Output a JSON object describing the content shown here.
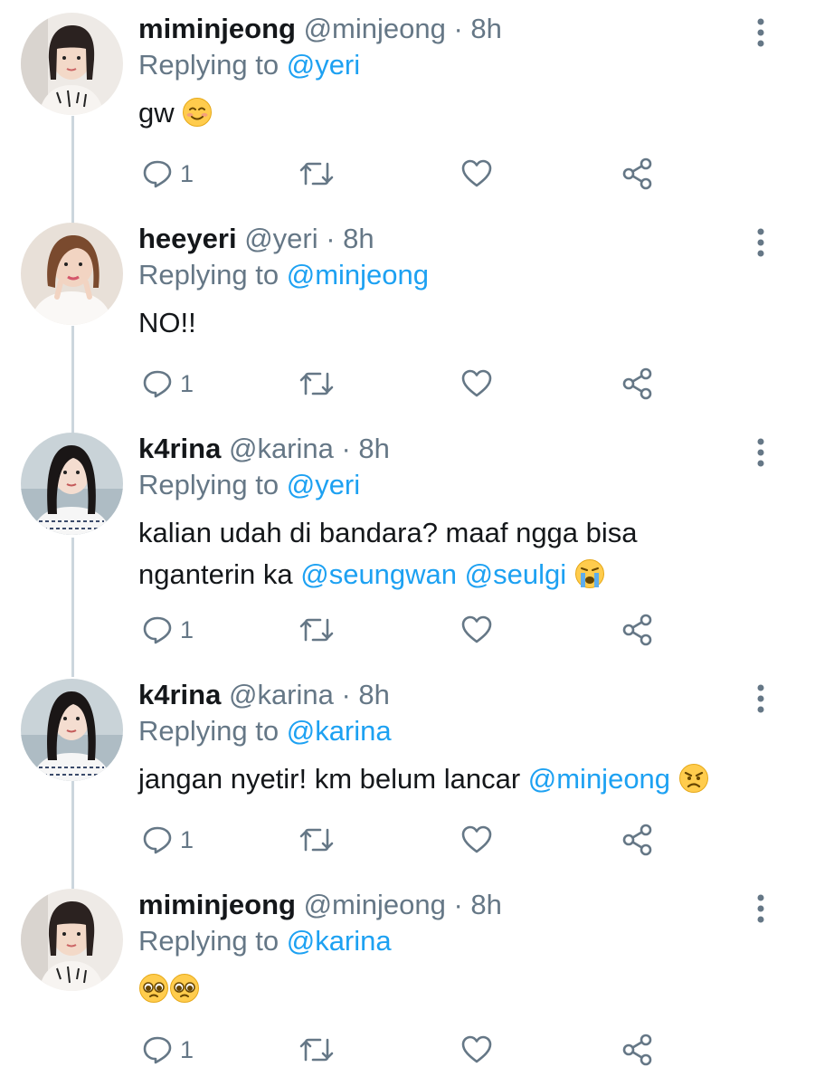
{
  "replies": [
    {
      "display_name": "miminjeong",
      "handle": "@minjeong",
      "time": "· 8h",
      "replying_label": "Replying to",
      "replying_to": "@yeri",
      "text_1": "gw",
      "emoji": "smiling-face-icon",
      "reply_count": "1",
      "avatar": "avatar-miminjeong"
    },
    {
      "display_name": "heeyeri",
      "handle": "@yeri",
      "time": "· 8h",
      "replying_label": "Replying to",
      "replying_to": "@minjeong",
      "text_1": "NO!!",
      "reply_count": "1",
      "avatar": "avatar-heeyeri"
    },
    {
      "display_name": "k4rina",
      "handle": "@karina",
      "time": "· 8h",
      "replying_label": "Replying to",
      "replying_to": "@yeri",
      "text_1": "kalian udah di bandara? maaf ngga bisa",
      "text_2": "nganterin ka ",
      "mention_1": "@seungwan",
      "mention_2": "@seulgi",
      "emoji": "loudly-crying-face-icon",
      "reply_count": "1",
      "avatar": "avatar-k4rina"
    },
    {
      "display_name": "k4rina",
      "handle": "@karina",
      "time": "· 8h",
      "replying_label": "Replying to",
      "replying_to": "@karina",
      "text_1": "jangan nyetir! km belum lancar ",
      "mention_1": "@minjeong",
      "emoji": "angry-face-icon",
      "reply_count": "1",
      "avatar": "avatar-k4rina"
    },
    {
      "display_name": "miminjeong",
      "handle": "@minjeong",
      "time": "· 8h",
      "replying_label": "Replying to",
      "replying_to": "@karina",
      "emoji": "pleading-face-icon",
      "reply_count": "1",
      "avatar": "avatar-miminjeong"
    }
  ],
  "colors": {
    "accent": "#1da1f2",
    "secondary_text": "#657786",
    "thread_line": "#ccd6dd"
  }
}
